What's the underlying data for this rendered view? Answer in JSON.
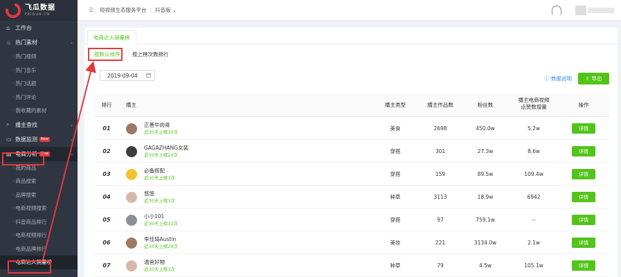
{
  "logo": {
    "title": "飞瓜数据",
    "sub": "FEIGUA.CN"
  },
  "sidebar": {
    "items": [
      {
        "label": "工作台",
        "icon": "home-icon",
        "type": "top"
      },
      {
        "label": "热门素材",
        "icon": "flame-icon",
        "type": "top",
        "chevron": true
      },
      {
        "label": "热门视频",
        "type": "sub"
      },
      {
        "label": "热门音乐",
        "type": "sub"
      },
      {
        "label": "热门话题",
        "type": "sub"
      },
      {
        "label": "热门评论",
        "type": "sub"
      },
      {
        "label": "我收藏的素材",
        "type": "sub"
      },
      {
        "label": "播主查找",
        "icon": "search-icon",
        "type": "top",
        "chevron": true
      },
      {
        "label": "数据监测",
        "icon": "monitor-icon",
        "type": "top",
        "chevron": true,
        "badge": "New"
      },
      {
        "label": "电商分析",
        "icon": "shop-icon",
        "type": "top",
        "chevron": true,
        "badge": "New",
        "active": true
      },
      {
        "label": "我的商品",
        "type": "sub"
      },
      {
        "label": "商品搜索",
        "type": "sub"
      },
      {
        "label": "品牌搜索",
        "type": "sub"
      },
      {
        "label": "电商视频搜索",
        "type": "sub"
      },
      {
        "label": "抖音商品排行",
        "type": "sub"
      },
      {
        "label": "电商视频排行",
        "type": "sub"
      },
      {
        "label": "电商品牌排行",
        "type": "sub"
      },
      {
        "label": "电商达人销量榜",
        "type": "sub",
        "selected": true
      }
    ]
  },
  "header": {
    "breadcrumb": [
      "短视频生态服务平台",
      "抖音版"
    ]
  },
  "main": {
    "tab": "电商达人销量榜",
    "subtabs": [
      "按默认排序",
      "按上榜次数排行"
    ],
    "date": "2019-09-04",
    "help_label": "数据说明",
    "export_label": "导出",
    "columns": [
      "排行",
      "播主",
      "播主类型",
      "播主作品数",
      "粉丝数",
      "播主电商视频\n点赞数增量",
      "操作"
    ],
    "detail_label": "详情",
    "rows": [
      {
        "rank": "01",
        "name": "正善牛肉哥",
        "streak": "近30天上榜30次",
        "type": "美食",
        "works": "2698",
        "fans": "450.0w",
        "likes": "5.2w",
        "avatar": "brown"
      },
      {
        "rank": "02",
        "name": "GAGAZHANG女装",
        "streak": "近30天上榜20次",
        "type": "穿搭",
        "works": "301",
        "fans": "27.3w",
        "likes": "8.6w",
        "avatar": "dark"
      },
      {
        "rank": "03",
        "name": "必备搭配",
        "streak": "近30天上榜1次",
        "type": "穿搭",
        "works": "159",
        "fans": "89.5w",
        "likes": "109.4w",
        "avatar": "yellow"
      },
      {
        "rank": "04",
        "name": "悠悠",
        "streak": "近30天上榜3次",
        "type": "种草",
        "works": "3113",
        "fans": "18.9w",
        "likes": "6942",
        "avatar": "light"
      },
      {
        "rank": "05",
        "name": "小小101",
        "streak": "近30天上榜11次",
        "type": "穿搭",
        "works": "97",
        "fans": "759.1w",
        "likes": "--",
        "avatar": "gray"
      },
      {
        "rank": "06",
        "name": "李佳琦Austin",
        "streak": "近30天上榜29次",
        "type": "美妆",
        "works": "221",
        "fans": "3134.0w",
        "likes": "2.1w",
        "avatar": "brown"
      },
      {
        "rank": "07",
        "name": "温爸好物",
        "streak": "近30天上榜1次",
        "type": "种草",
        "works": "79",
        "fans": "4.5w",
        "likes": "105.1w",
        "avatar": "light"
      }
    ]
  },
  "colors": {
    "accent": "#52c41a",
    "highlight": "#e4393c",
    "sidebar": "#2f3541"
  }
}
